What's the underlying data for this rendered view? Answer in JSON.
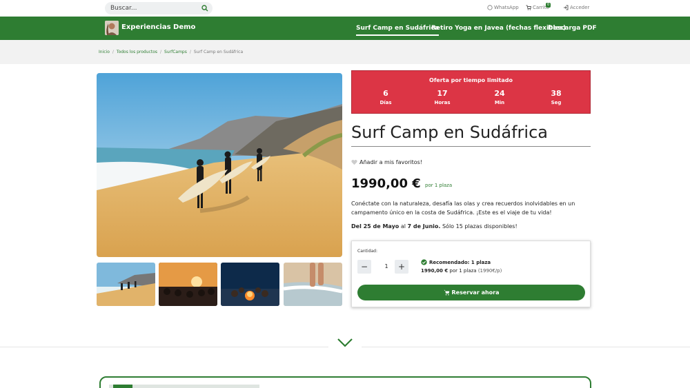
{
  "search": {
    "placeholder": "Buscar..."
  },
  "toplinks": {
    "whatsapp": "WhatsApp",
    "cart": "Carrito",
    "cart_count": "0",
    "login": "Acceder"
  },
  "header": {
    "brand": "Experiencias Demo",
    "nav": [
      {
        "label": "Surf Camp en Sudáfrica"
      },
      {
        "label": "Retiro Yoga en Javea (fechas flexibles)"
      },
      {
        "label": "Descarga PDF"
      }
    ]
  },
  "breadcrumb": {
    "home": "Inicio",
    "all": "Todos los productos",
    "category": "SurfCamps",
    "current": "Surf Camp en Sudáfrica",
    "sep": "/"
  },
  "countdown": {
    "title": "Oferta por tiempo limitado",
    "units": [
      {
        "value": "6",
        "label": "Días"
      },
      {
        "value": "17",
        "label": "Horas"
      },
      {
        "value": "24",
        "label": "Min"
      },
      {
        "value": "38",
        "label": "Seg"
      }
    ]
  },
  "product": {
    "title": "Surf Camp en Sudáfrica",
    "favorite": "Añadir a mis favoritos!",
    "price": "1990,00 €",
    "per": "por 1 plaza",
    "description": "Conéctate con la naturaleza, desafía las olas y crea recuerdos inolvidables en un campamento único en la costa de Sudáfrica. ¡Este es el viaje de tu vida!",
    "dates_bold": "Del 25 de Mayo",
    "dates_mid": " al ",
    "dates_bold2": "7 de Junio.",
    "dates_rest": " Sólo 15 plazas disponibles!"
  },
  "booking": {
    "qty_label": "Cantidad:",
    "minus": "−",
    "plus": "+",
    "qty_value": "1",
    "recommended": "Recomendado: 1 plaza",
    "rec_price": "1990,00 €",
    "rec_per": " por 1 plaza ",
    "rec_unit": "(1990€/p)",
    "reserve": "Reservar ahora"
  },
  "colors": {
    "brand": "#2e7d32",
    "countdown": "#dc3545"
  }
}
